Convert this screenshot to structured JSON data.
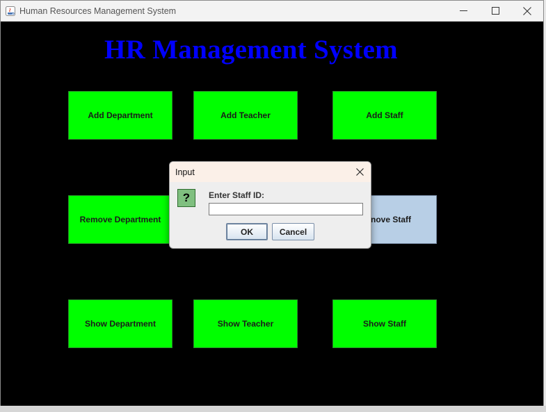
{
  "window": {
    "title": "Human Resources Management System",
    "controls": [
      "minimize-icon",
      "maximize-icon",
      "close-icon"
    ]
  },
  "main": {
    "heading": "HR Management System",
    "buttons": [
      {
        "label": "Add Department"
      },
      {
        "label": "Add Teacher"
      },
      {
        "label": "Add Staff"
      },
      {
        "label": "Remove Department"
      },
      {
        "label": "nove Staff"
      },
      {
        "label": "Show Department"
      },
      {
        "label": "Show Teacher"
      },
      {
        "label": "Show Staff"
      }
    ]
  },
  "dialog": {
    "title": "Input",
    "icon": "question-icon",
    "icon_glyph": "?",
    "prompt": "Enter Staff ID:",
    "input_value": "",
    "ok_label": "OK",
    "cancel_label": "Cancel"
  },
  "colors": {
    "background": "#000000",
    "heading": "#0000ff",
    "button": "#00ff00",
    "pressed_button": "#b8cfe6"
  }
}
